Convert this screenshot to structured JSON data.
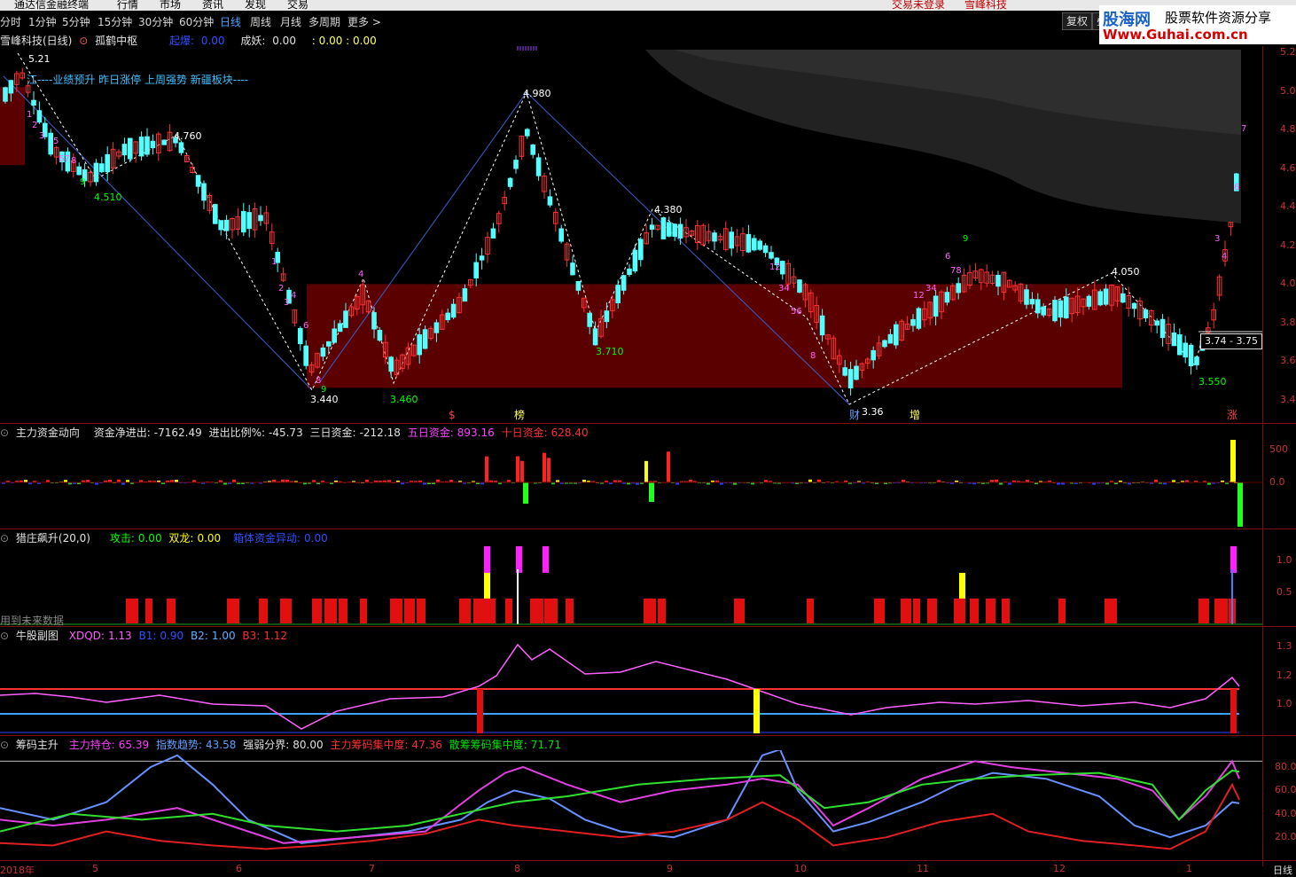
{
  "menubar": {
    "items": [
      "通达信金融终端",
      "行情",
      "市场",
      "资讯",
      "发现",
      "交易"
    ],
    "login": "交易未登录",
    "stock_short": "雪峰科技"
  },
  "periods": [
    "分时",
    "1分钟",
    "5分钟",
    "15分钟",
    "30分钟",
    "60分钟",
    "日线",
    "周线",
    "月线",
    "多周期",
    "更多 >"
  ],
  "header_buttons": [
    "复权",
    "叠"
  ],
  "logo": {
    "brand": "股海网",
    "slogan": "股票软件资源分享",
    "url": "Www.Guhai.com.cn"
  },
  "main_panel": {
    "stock": "雪峰科技(日线)",
    "indicator": "孤鹤中枢",
    "label_qidong": "起爆:",
    "qidong": "0.00",
    "label_chengyao": "成妖:",
    "chengyao": "0.00",
    "extra": ": 0.00 : 0.00",
    "news": "江----业绩预升 昨日涨停 上周强势 新疆板块----",
    "price_labels": [
      "5.21",
      "4.760",
      "4.510",
      "4.980",
      "4.380",
      "3.440",
      "3.460",
      "3.710",
      "4.050",
      "3.550",
      "3.36"
    ],
    "range_box": "3.74 - 3.75",
    "yaxis": [
      "5.2",
      "5.0",
      "4.8",
      "4.6",
      "4.4",
      "4.2",
      "4.0",
      "3.8",
      "3.6",
      "3.4"
    ],
    "markers": [
      "$",
      "榜",
      "财",
      "增",
      "涨"
    ]
  },
  "fund_panel": {
    "title": "主力资金动向",
    "l1": "资金净进出:",
    "v1": "-7162.49",
    "l2": "进出比例%:",
    "v2": "-45.73",
    "l3": "三日资金:",
    "v3": "-212.18",
    "l4": "五日资金:",
    "v4": "893.16",
    "l5": "十日资金:",
    "v5": "628.40",
    "yaxis": [
      "500",
      "0.0"
    ]
  },
  "zhuang_panel": {
    "title": "猎庄飙升(20,0)",
    "l1": "攻击:",
    "v1": "0.00",
    "l2": "双龙:",
    "v2": "0.00",
    "l3": "箱体资金异动:",
    "v3": "0.00",
    "note": "用到未来数据",
    "yaxis": [
      "1.0",
      "0.5"
    ]
  },
  "bull_panel": {
    "title": "牛股副图",
    "l1": "XDQD:",
    "v1": "1.13",
    "l2": "B1:",
    "v2": "0.90",
    "l3": "B2:",
    "v3": "1.00",
    "l4": "B3:",
    "v4": "1.12",
    "yaxis": [
      "1.3",
      "1.2",
      "1.0"
    ]
  },
  "chip_panel": {
    "title": "筹码主升",
    "l1": "主力持仓:",
    "v1": "65.39",
    "l2": "指数趋势:",
    "v2": "43.58",
    "l3": "强弱分界:",
    "v3": "80.00",
    "l4": "主力筹码集中度:",
    "v4": "47.36",
    "l5": "散筹筹码集中度:",
    "v5": "71.71",
    "yaxis": [
      "80.0",
      "60.0",
      "40.0",
      "20.0"
    ]
  },
  "xaxis": {
    "labels": [
      "2018年",
      "5",
      "6",
      "7",
      "8",
      "9",
      "10",
      "11",
      "12",
      "1"
    ],
    "period": "日线"
  },
  "colors": {
    "up": "#ff3232",
    "down": "#54ffff",
    "box": "#5a0000",
    "gold": "#ffff00",
    "magenta": "#ff00ff",
    "green": "#00d000",
    "blue": "#4060ff"
  }
}
